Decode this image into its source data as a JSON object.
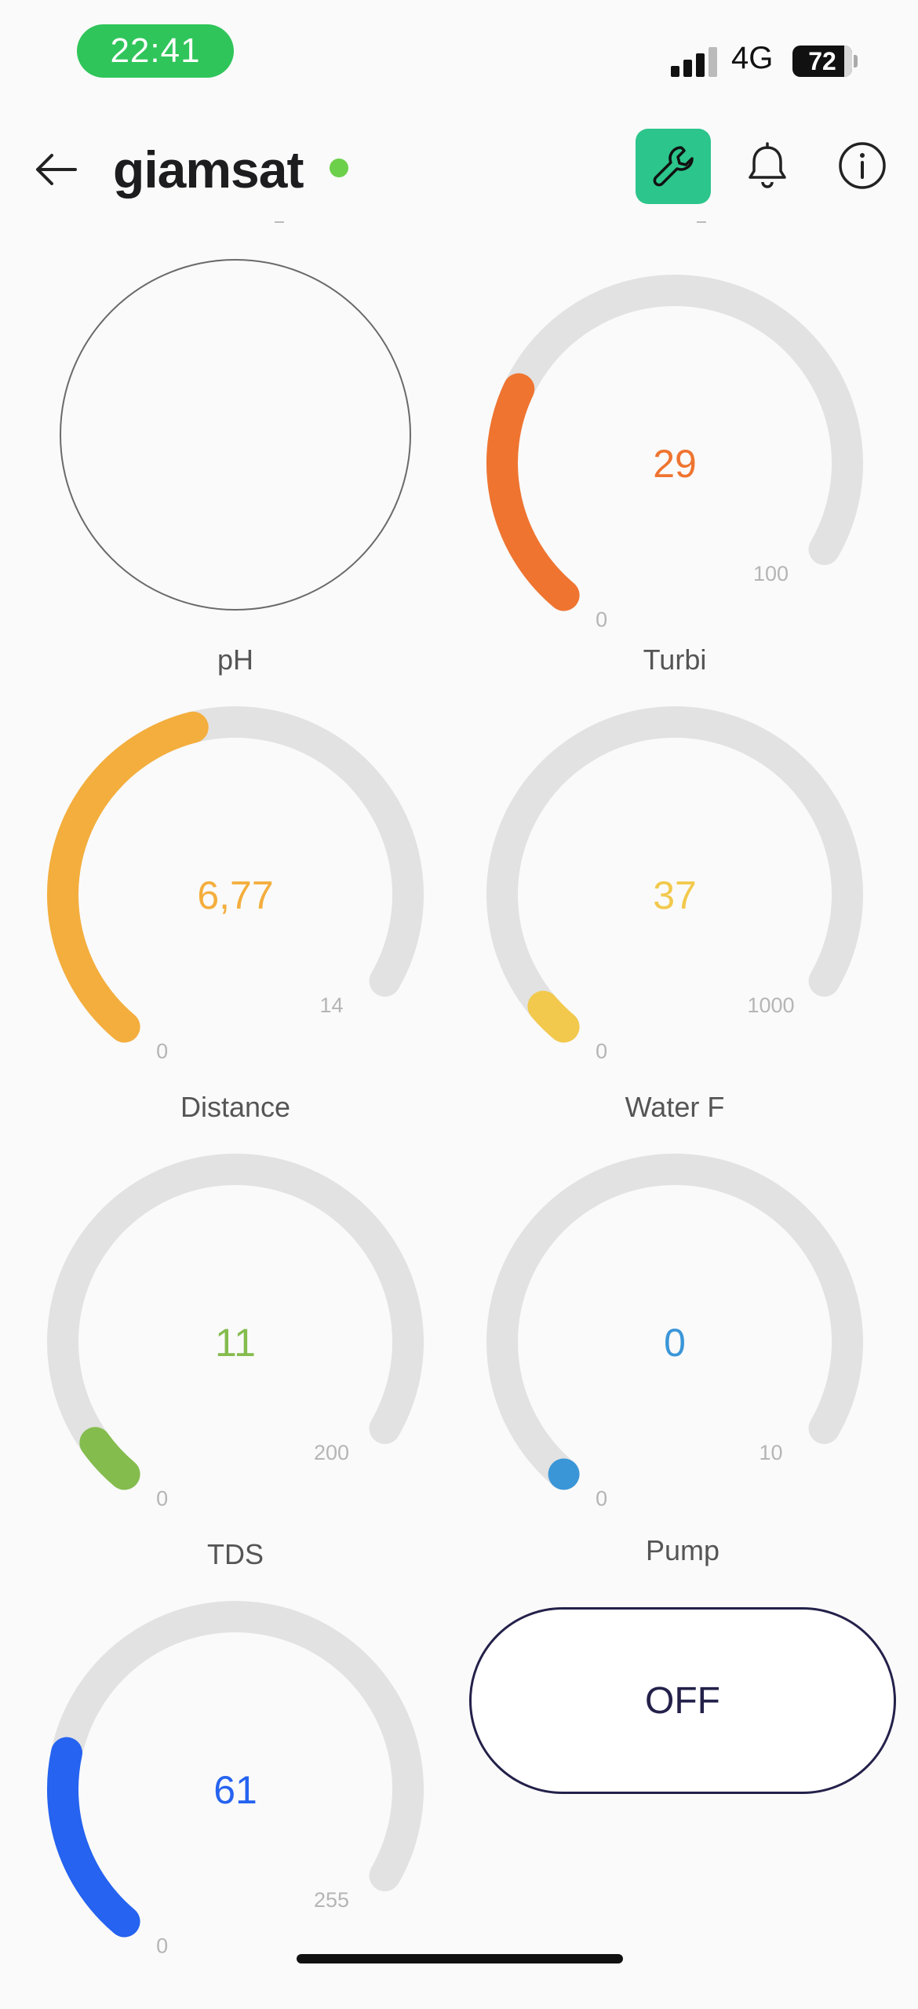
{
  "status_bar": {
    "time": "22:41",
    "network": "4G",
    "battery": "72"
  },
  "header": {
    "title": "giamsat"
  },
  "gauges": [
    {
      "id": "top-right",
      "label": "",
      "value": 29,
      "display": "29",
      "min": 0,
      "max": 100,
      "min_label": "0",
      "max_label": "100",
      "color": "#ef7430"
    },
    {
      "id": "ph",
      "label": "pH",
      "value": 6.77,
      "display": "6,77",
      "min": 0,
      "max": 14,
      "min_label": "0",
      "max_label": "14",
      "color": "#f4ae3d"
    },
    {
      "id": "turbi",
      "label": "Turbi",
      "value": 37,
      "display": "37",
      "min": 0,
      "max": 1000,
      "min_label": "0",
      "max_label": "1000",
      "color": "#f2c94c"
    },
    {
      "id": "distance",
      "label": "Distance",
      "value": 11,
      "display": "11",
      "min": 0,
      "max": 200,
      "min_label": "0",
      "max_label": "200",
      "color": "#84bc4e"
    },
    {
      "id": "water-flow",
      "label": "Water F",
      "value": 0,
      "display": "0",
      "min": 0,
      "max": 10,
      "min_label": "0",
      "max_label": "10",
      "color": "#3b96d8"
    },
    {
      "id": "tds",
      "label": "TDS",
      "value": 61,
      "display": "61",
      "min": 0,
      "max": 255,
      "min_label": "0",
      "max_label": "255",
      "color": "#2563f0"
    }
  ],
  "pump": {
    "label": "Pump",
    "state": "OFF"
  },
  "colors": {
    "accent": "#2cc58c",
    "online": "#6cd04b",
    "track": "#e2e2e2"
  }
}
